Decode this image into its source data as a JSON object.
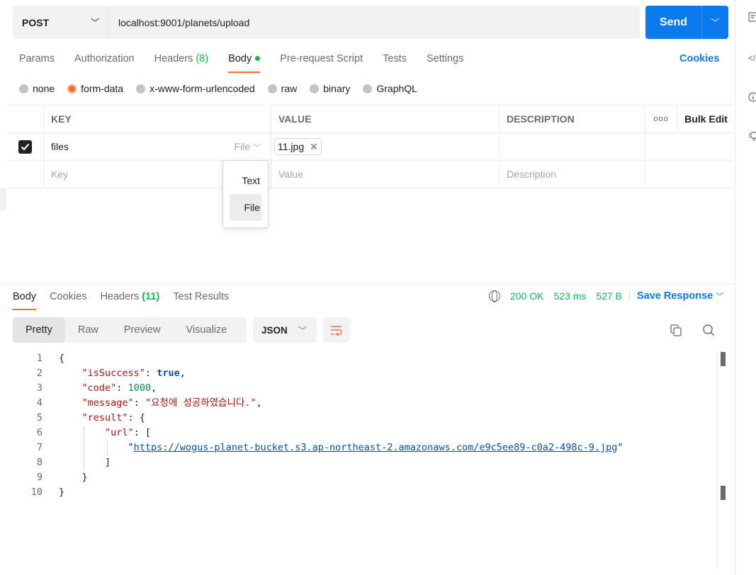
{
  "request": {
    "method": "POST",
    "url": "localhost:9001/planets/upload",
    "send_label": "Send",
    "tabs": [
      {
        "label": "Params"
      },
      {
        "label": "Authorization"
      },
      {
        "label": "Headers",
        "count": "(8)"
      },
      {
        "label": "Body"
      },
      {
        "label": "Pre-request Script"
      },
      {
        "label": "Tests"
      },
      {
        "label": "Settings"
      }
    ],
    "cookies_label": "Cookies",
    "body_types": [
      "none",
      "form-data",
      "x-www-form-urlencoded",
      "raw",
      "binary",
      "GraphQL"
    ],
    "selected_body_type": "form-data"
  },
  "params_table": {
    "headers": {
      "key": "KEY",
      "value": "VALUE",
      "description": "DESCRIPTION",
      "bulk_edit": "Bulk Edit"
    },
    "rows": [
      {
        "key": "files",
        "type": "File",
        "value": "11.jpg",
        "checked": true
      }
    ],
    "placeholders": {
      "key": "Key",
      "value": "Value",
      "description": "Description"
    }
  },
  "type_dropdown": {
    "options": [
      "Text",
      "File"
    ],
    "selected": "File"
  },
  "response": {
    "tabs": [
      {
        "label": "Body"
      },
      {
        "label": "Cookies"
      },
      {
        "label": "Headers",
        "count": "(11)"
      },
      {
        "label": "Test Results"
      }
    ],
    "status": "200 OK",
    "time": "523 ms",
    "size": "527 B",
    "save_label": "Save Response",
    "views": [
      "Pretty",
      "Raw",
      "Preview",
      "Visualize"
    ],
    "format": "JSON",
    "lines": [
      "1",
      "2",
      "3",
      "4",
      "5",
      "6",
      "7",
      "8",
      "9",
      "10"
    ],
    "json": {
      "isSuccess_key": "\"isSuccess\"",
      "isSuccess_val": "true",
      "code_key": "\"code\"",
      "code_val": "1000",
      "message_key": "\"message\"",
      "message_val": "\"요청에 성공하였습니다.\"",
      "result_key": "\"result\"",
      "url_key": "\"url\"",
      "url_val": "https://wogus-planet-bucket.s3.ap-northeast-2.amazonaws.com/e9c5ee89-c0a2-498c-9.jpg"
    }
  },
  "colors": {
    "accent": "#ff6c37",
    "primary": "#097bed",
    "success": "#0cbb52"
  }
}
